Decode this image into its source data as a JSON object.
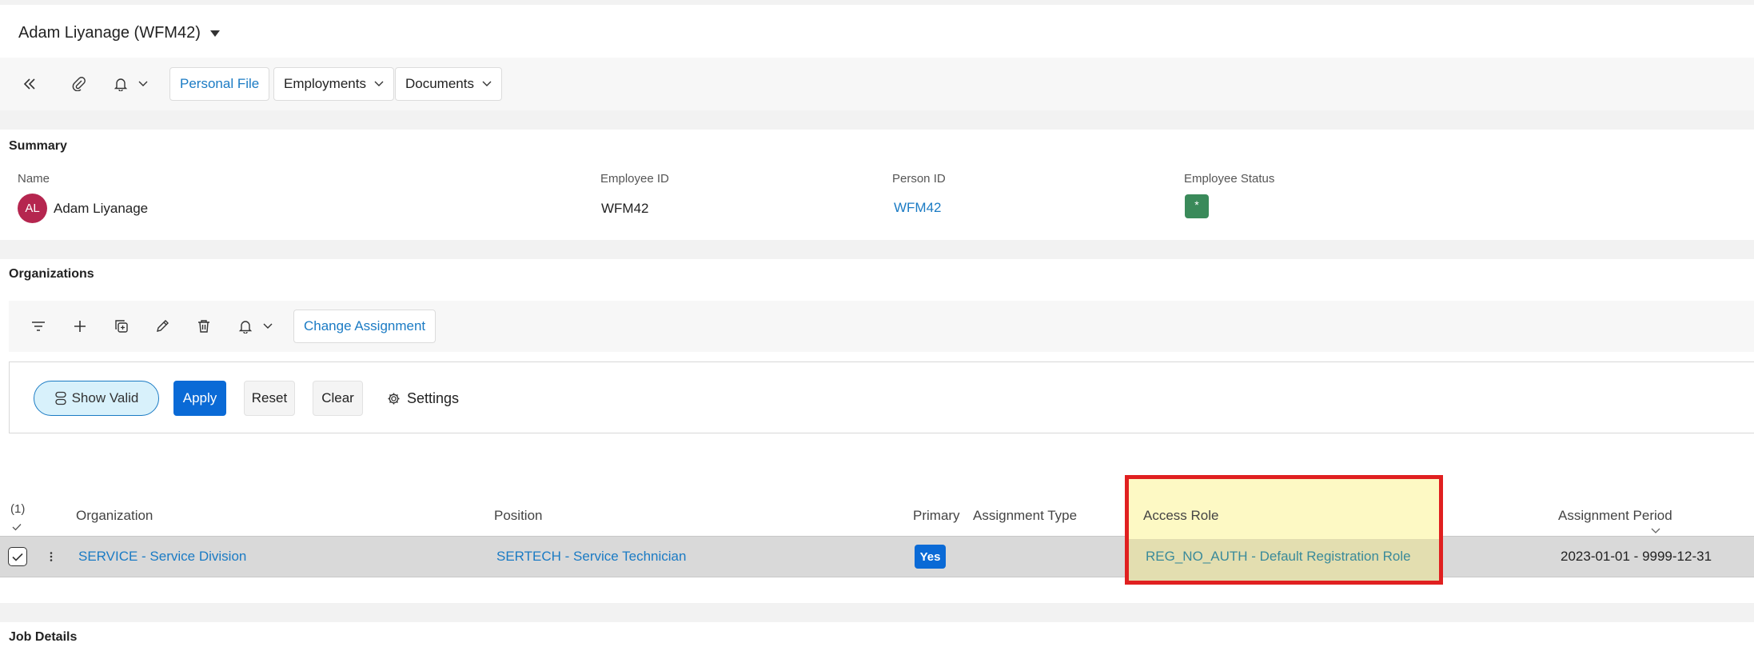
{
  "header": {
    "title": "Adam Liyanage (WFM42)"
  },
  "toolbar": {
    "personal_file": "Personal File",
    "employments": "Employments",
    "documents": "Documents"
  },
  "summary": {
    "title": "Summary",
    "name_label": "Name",
    "avatar_initials": "AL",
    "name_value": "Adam Liyanage",
    "employee_id_label": "Employee ID",
    "employee_id_value": "WFM42",
    "person_id_label": "Person ID",
    "person_id_value": "WFM42",
    "status_label": "Employee Status",
    "status_value": "*",
    "avatar_color": "#b5264f",
    "status_color": "#3a8a5a"
  },
  "organizations": {
    "title": "Organizations",
    "change_assignment": "Change Assignment",
    "filters": {
      "show_valid": "Show Valid",
      "apply": "Apply",
      "reset": "Reset",
      "clear": "Clear",
      "settings": "Settings"
    },
    "table": {
      "selected_count": "(1)",
      "columns": [
        "Organization",
        "Position",
        "Primary",
        "Assignment Type",
        "Access Role",
        "Assignment Period"
      ],
      "rows": [
        {
          "organization": "SERVICE - Service Division",
          "position": "SERTECH - Service Technician",
          "primary": "Yes",
          "assignment_type": "",
          "access_role": "REG_NO_AUTH - Default Registration Role",
          "assignment_period": "2023-01-01 - 9999-12-31"
        }
      ]
    }
  },
  "job_details": {
    "title": "Job Details"
  },
  "colors": {
    "accent": "#0a6ad6",
    "link": "#1b7bc4",
    "highlight": "#fdf9c4",
    "highlight_border": "#e02020"
  }
}
